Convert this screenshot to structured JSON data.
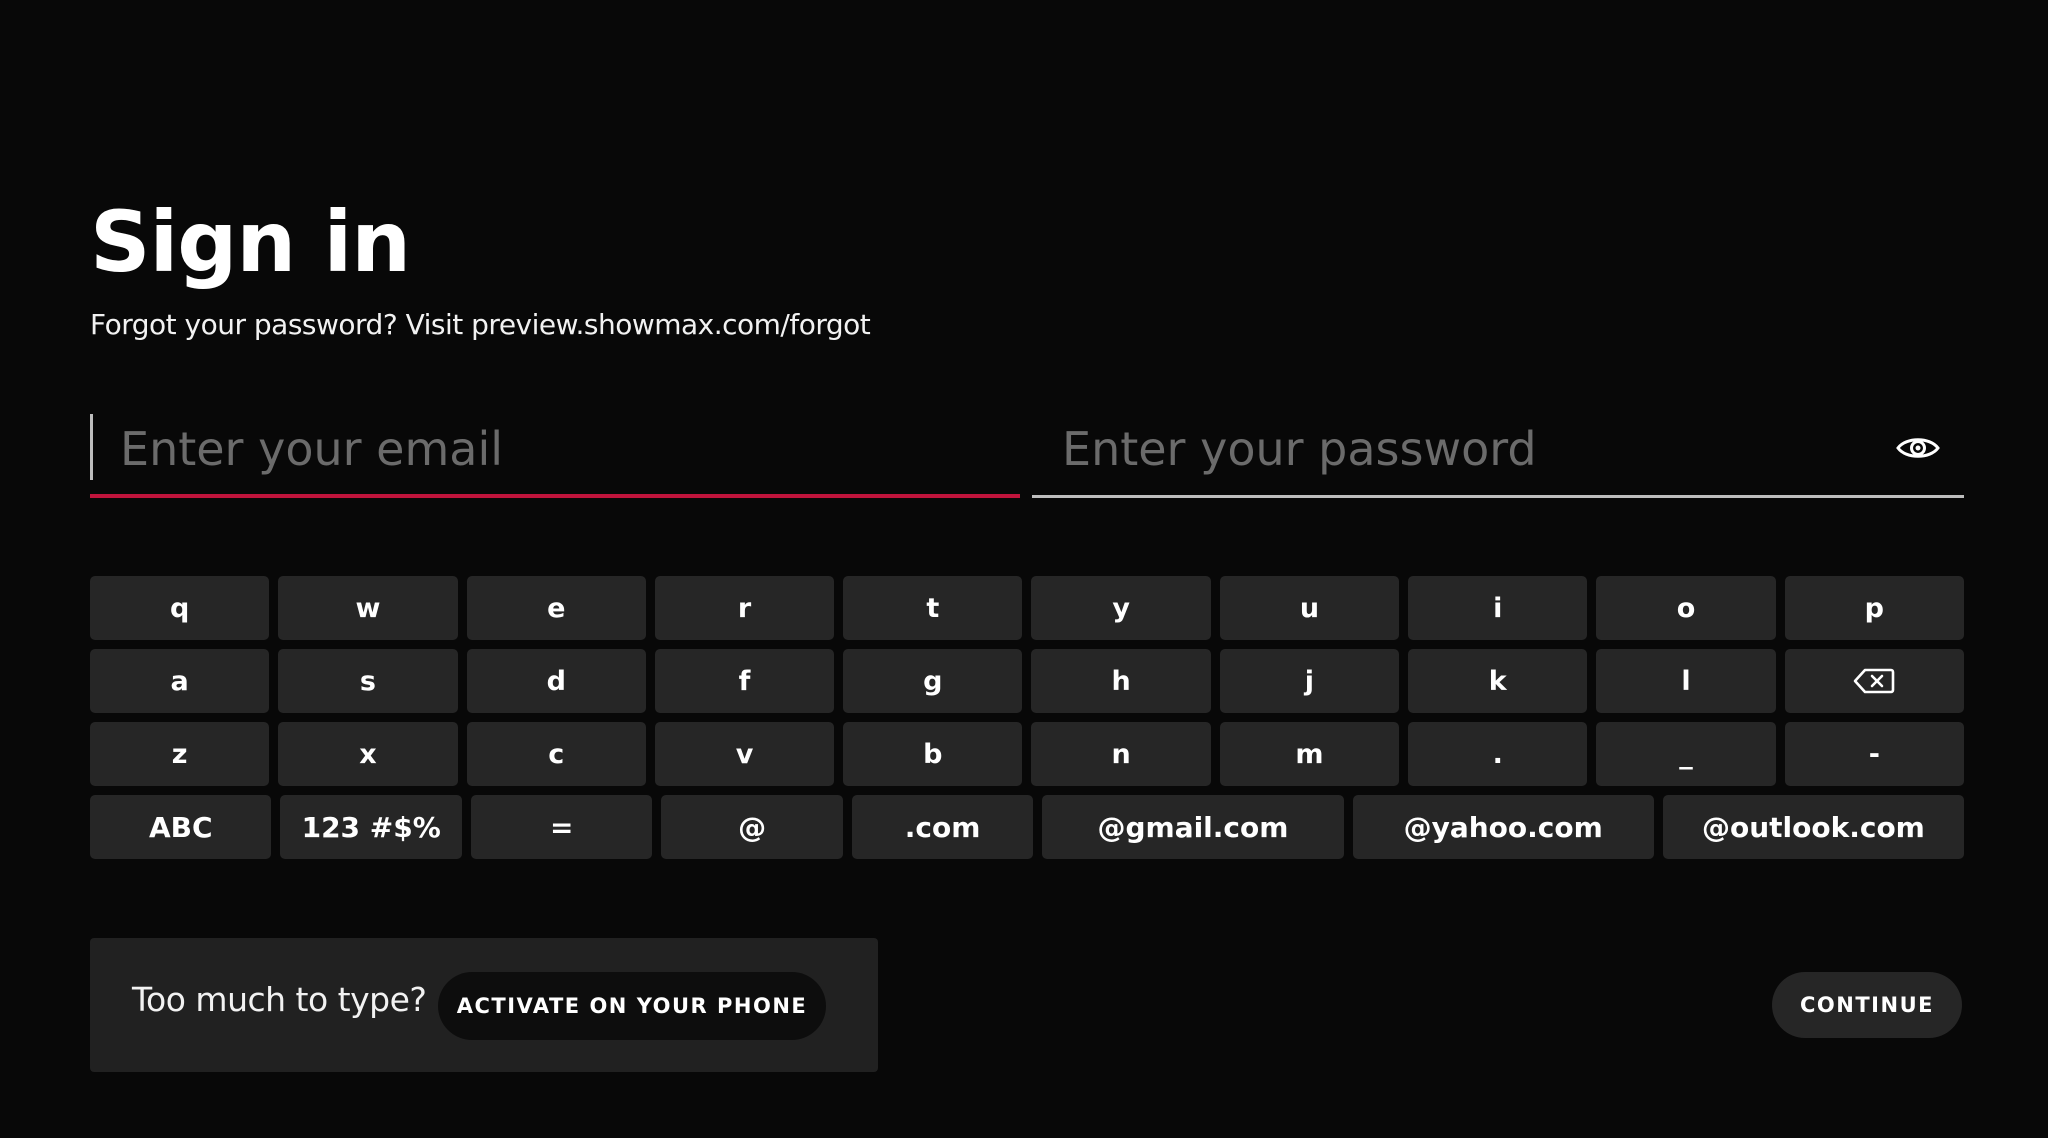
{
  "page": {
    "title": "Sign in",
    "subtitle": "Forgot your password? Visit preview.showmax.com/forgot"
  },
  "form": {
    "email": {
      "value": "",
      "placeholder": "Enter your email",
      "focused": true
    },
    "password": {
      "value": "",
      "placeholder": "Enter your password",
      "toggle_icon": "eye-icon"
    }
  },
  "keyboard": {
    "rows": [
      [
        "q",
        "w",
        "e",
        "r",
        "t",
        "y",
        "u",
        "i",
        "o",
        "p"
      ],
      [
        "a",
        "s",
        "d",
        "f",
        "g",
        "h",
        "j",
        "k",
        "l",
        "backspace-icon"
      ],
      [
        "z",
        "x",
        "c",
        "v",
        "b",
        "n",
        "m",
        ".",
        "_",
        "-"
      ],
      [
        "ABC",
        "123 #$%",
        "=",
        "@",
        ".com",
        "@gmail.com",
        "@yahoo.com",
        "@outlook.com"
      ]
    ]
  },
  "panel": {
    "text": "Too much to type?",
    "activate_label": "ACTIVATE ON YOUR PHONE"
  },
  "continue_label": "CONTINUE",
  "colors": {
    "background": "#080808",
    "accent": "#c0143c",
    "key": "#262626",
    "panel": "#212121"
  }
}
